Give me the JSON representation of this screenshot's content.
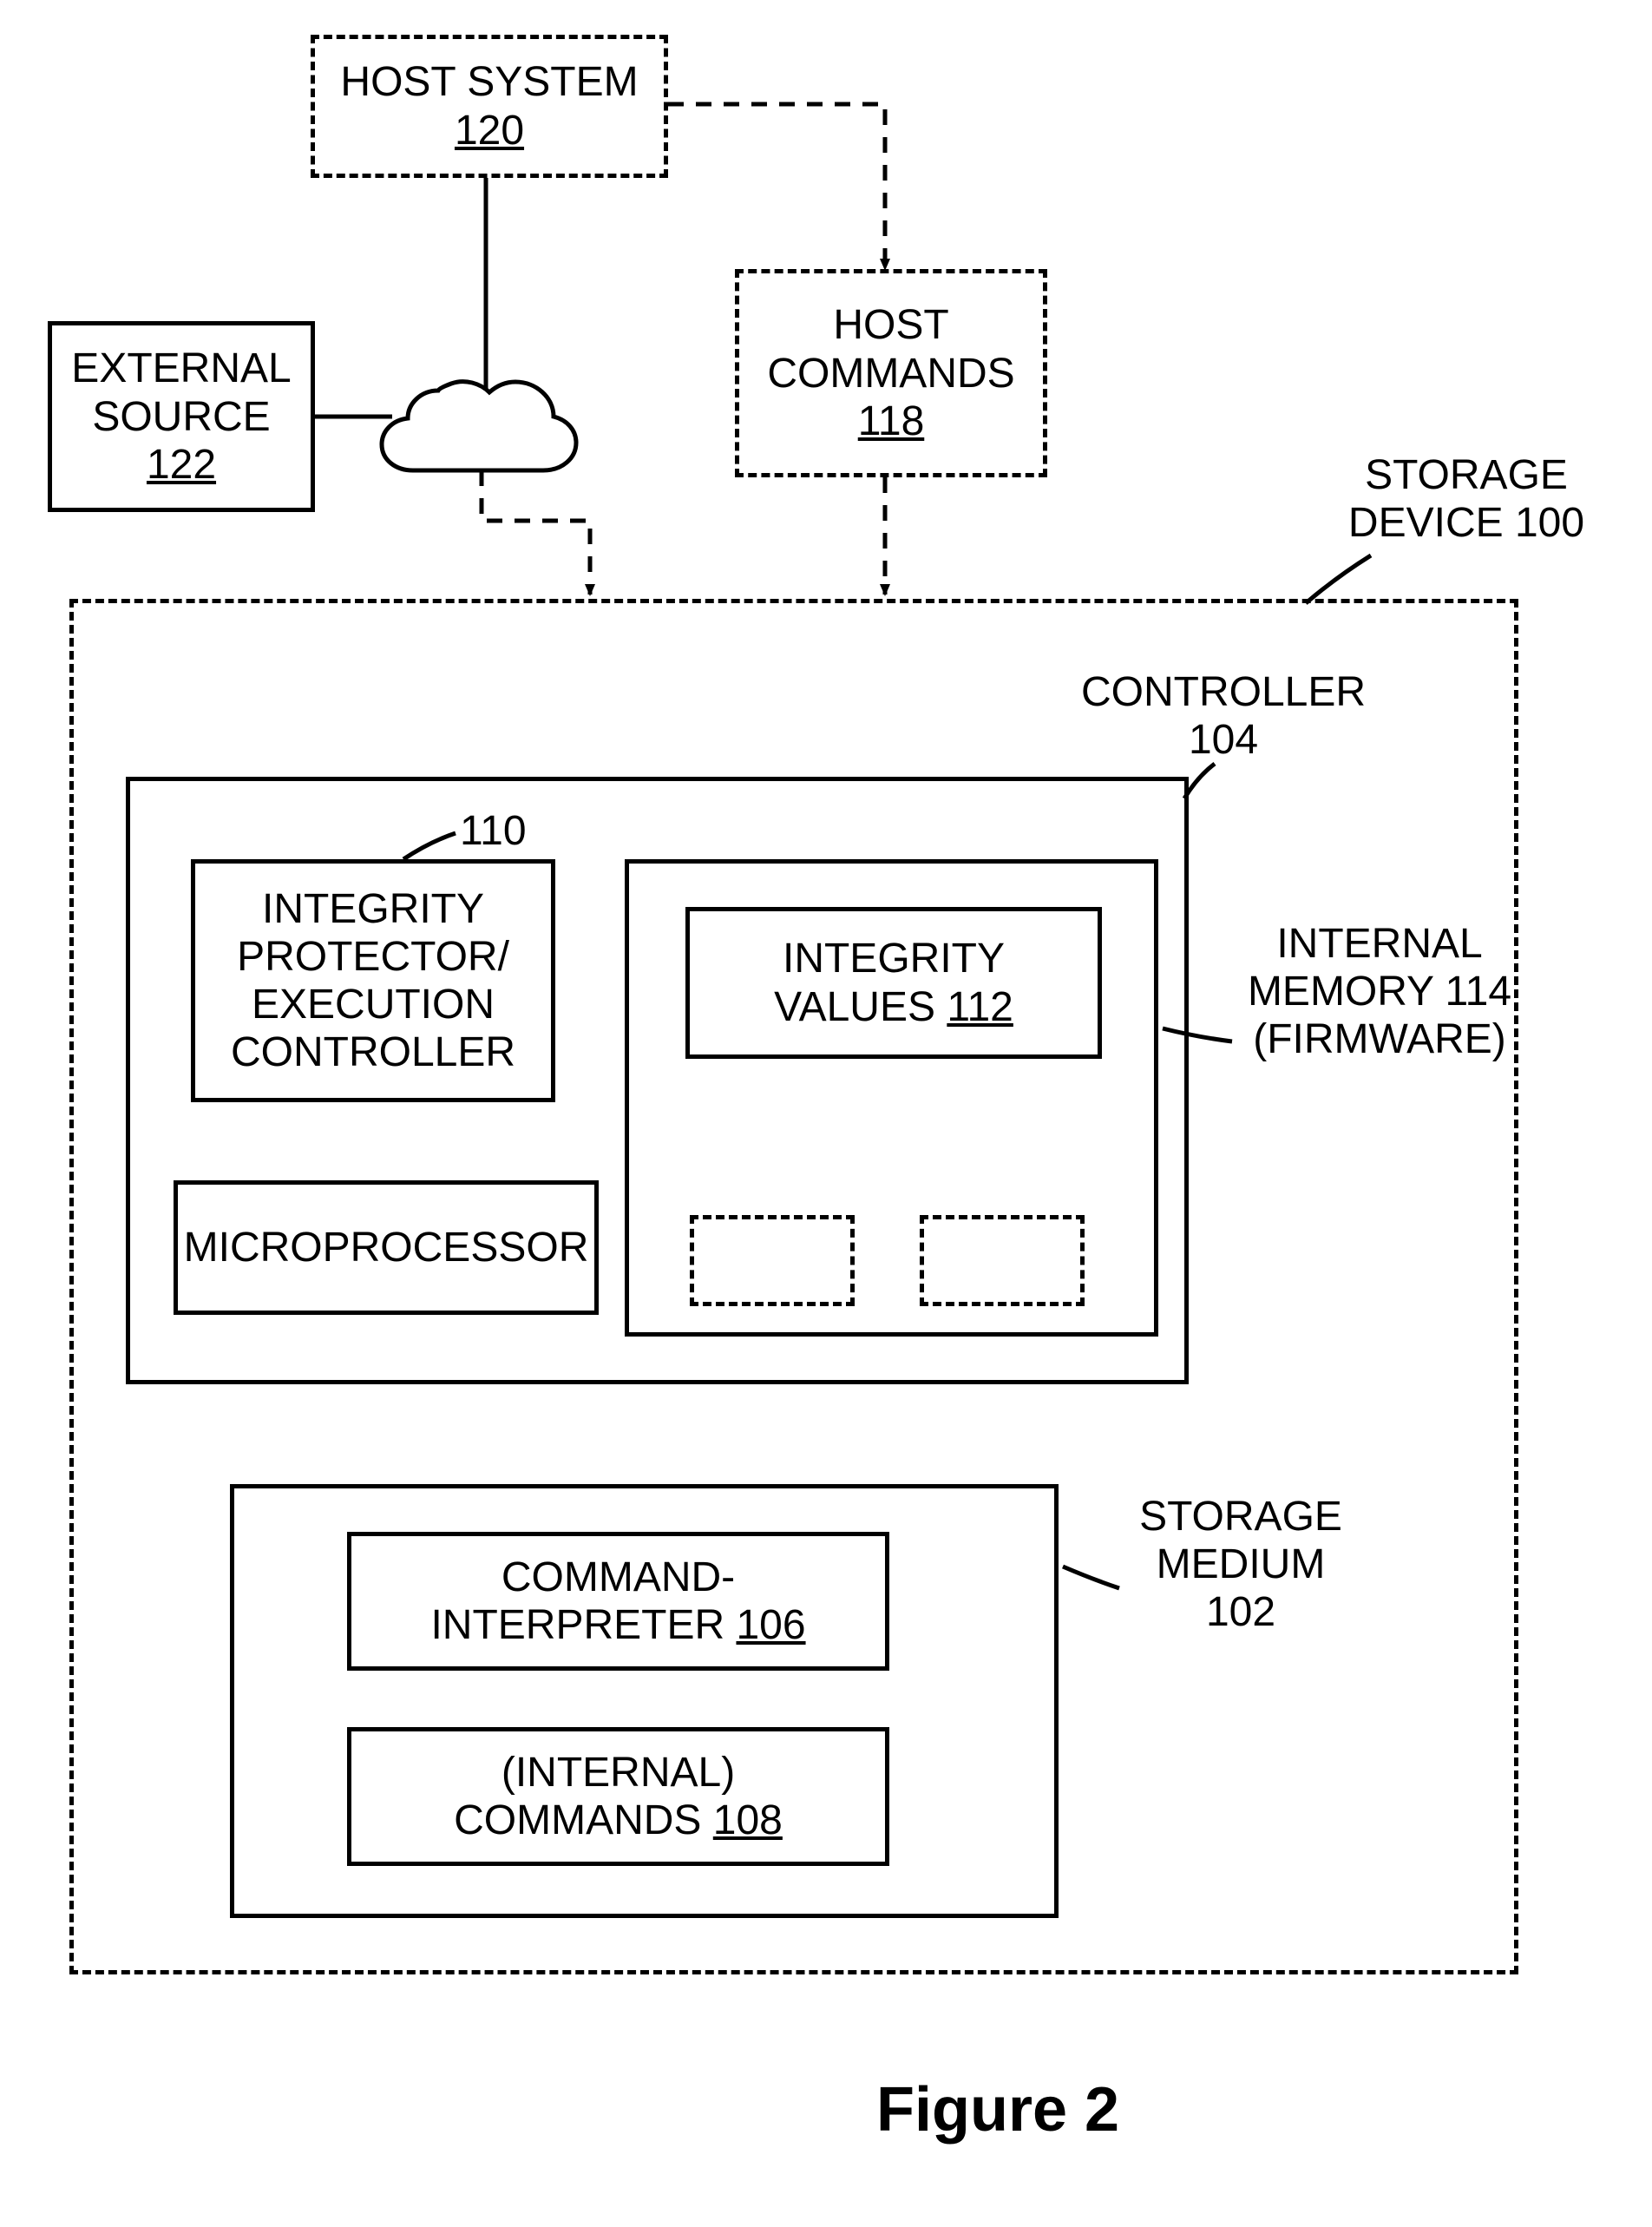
{
  "hostSystem": {
    "label": "HOST SYSTEM",
    "ref": "120"
  },
  "externalSource": {
    "label_line1": "EXTERNAL",
    "label_line2": "SOURCE",
    "ref": "122"
  },
  "hostCommands": {
    "label_line1": "HOST",
    "label_line2": "COMMANDS",
    "ref": "118"
  },
  "storageDevice": {
    "label_line1": "STORAGE",
    "label_line2": "DEVICE 100"
  },
  "controller": {
    "label_line1": "CONTROLLER",
    "ref": "104"
  },
  "integrityProtector": {
    "line1": "INTEGRITY",
    "line2": "PROTECTOR/",
    "line3": "EXECUTION",
    "line4": "CONTROLLER",
    "ref": "110"
  },
  "integrityValues": {
    "label_line1": "INTEGRITY",
    "label_line2": "VALUES ",
    "ref": "112"
  },
  "internalMemory": {
    "line1": "INTERNAL",
    "line2": "MEMORY 114",
    "line3": "(FIRMWARE)"
  },
  "microprocessor": {
    "label": "MICROPROCESSOR"
  },
  "storageMedium": {
    "label_line1": "STORAGE",
    "label_line2": "MEDIUM",
    "ref": "102"
  },
  "commandInterpreter": {
    "label_line1": "COMMAND-",
    "label_line2": "INTERPRETER ",
    "ref": "106"
  },
  "internalCommands": {
    "label_line1": "(INTERNAL)",
    "label_line2": "COMMANDS ",
    "ref": "108"
  },
  "figure": "Figure 2"
}
